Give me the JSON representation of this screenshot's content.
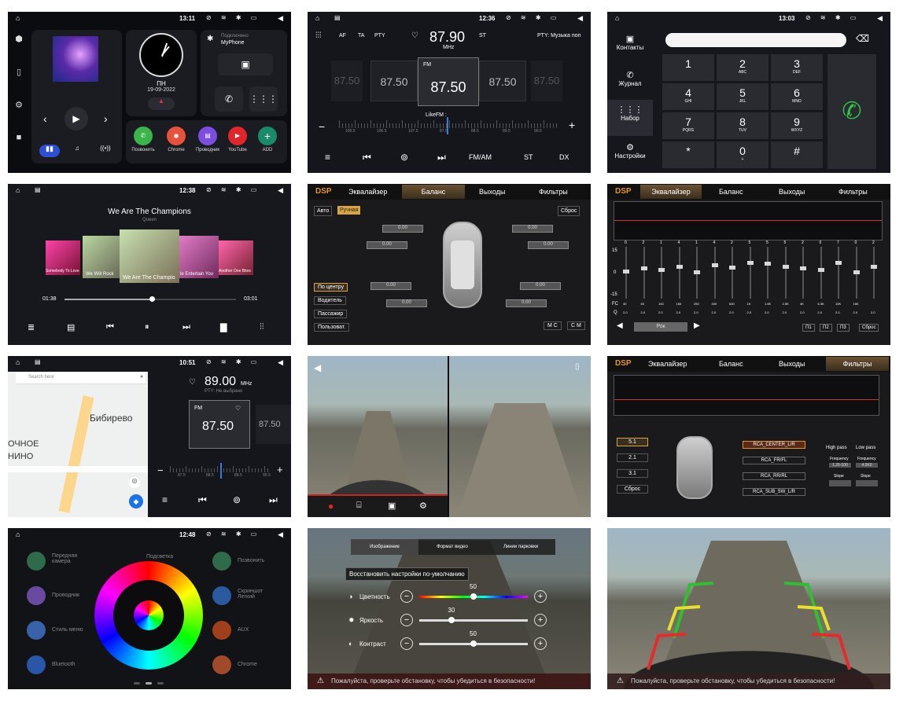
{
  "p1": {
    "time": "13:11",
    "side": [
      "cube-icon",
      "phone-icon",
      "gear-icon",
      "camera-icon"
    ],
    "day": "ПН",
    "date": "19-09-2022",
    "bt_title": "Подключено",
    "bt_device": "MyPhone",
    "apps": [
      {
        "label": "Позвонить",
        "color": "#3bb44a",
        "icon": "📞"
      },
      {
        "label": "Chrome",
        "color": "#e5533c",
        "icon": "◉"
      },
      {
        "label": "Проводник",
        "color": "#7b4de0",
        "icon": "▤"
      },
      {
        "label": "YouTube",
        "color": "#e0262a",
        "icon": "▶"
      },
      {
        "label": "ADD",
        "color": "#1a8b6a",
        "icon": "+"
      }
    ]
  },
  "p2": {
    "time": "12:36",
    "af": "AF",
    "ta": "TA",
    "pty": "PTY",
    "freq": "87.90",
    "mhz": "MHz",
    "st": "ST",
    "pty_text": "PTY: Музыка поп",
    "band": "FM",
    "cards": [
      "87.50",
      "87.50",
      "87.50",
      "87.50",
      "87.50"
    ],
    "like": "LikeFM :",
    "scale": [
      "105.5",
      "106.5",
      "107.5",
      "87.5",
      "88.5",
      "89.5",
      "90.5"
    ],
    "fmam": "FM/AM",
    "st2": "ST",
    "dx": "DX"
  },
  "p3": {
    "time": "13:03",
    "tabs": [
      "Контакты",
      "Журнал",
      "Набор",
      "Настройки"
    ],
    "keys": [
      [
        "1",
        ""
      ],
      [
        "2",
        "ABC"
      ],
      [
        "3",
        "DEF"
      ],
      [
        "4",
        "GHI"
      ],
      [
        "5",
        "JKL"
      ],
      [
        "6",
        "MNO"
      ],
      [
        "7",
        "PQRS"
      ],
      [
        "8",
        "TUV"
      ],
      [
        "9",
        "WXYZ"
      ],
      [
        "*",
        ""
      ],
      [
        "0",
        "+"
      ],
      [
        "#",
        ""
      ]
    ]
  },
  "p4": {
    "time": "12:38",
    "title": "We Are The Champions",
    "artist": "Queen",
    "albums": [
      "Somebody To Love",
      "We Will Rock",
      "We Are The Champio",
      "le Entertain You",
      "Another One Bites"
    ],
    "elapsed": "01:38",
    "total": "03:01",
    "progress": 0.51
  },
  "p5": {
    "dsp": "DSP",
    "tabs": [
      "Эквалайзер",
      "Баланс",
      "Выходы",
      "Фильтры"
    ],
    "auto": "Авто",
    "manual": "Ручная",
    "reset": "Сброс",
    "val": "0.00",
    "modes": [
      "По центру",
      "Водитель",
      "Пассажир",
      "Пользоват."
    ],
    "mc": "M C",
    "cm": "C M"
  },
  "p6": {
    "dsp": "DSP",
    "tabs": [
      "Эквалайзер",
      "Баланс",
      "Выходы",
      "Фильтры"
    ],
    "ylabels": [
      "15",
      "0",
      "-15"
    ],
    "gains": [
      "0",
      "2",
      "1",
      "2",
      "1",
      "2",
      "2",
      "3",
      "5",
      "2",
      "2",
      "1",
      "0",
      "2",
      "2"
    ],
    "gains_display": [
      "0",
      "2",
      "1",
      "4",
      "1",
      "4",
      "2",
      "5",
      "5",
      "5",
      "2",
      "0",
      "7",
      "0",
      "2"
    ],
    "fc": [
      "40",
      "63",
      "100",
      "160",
      "250",
      "400",
      "630",
      "1K",
      "1.6K",
      "2.5K",
      "4K",
      "6.3K",
      "10K",
      "16K"
    ],
    "fc_label": "FC",
    "q_label": "Q",
    "q": "2.0",
    "preset": "Рок",
    "p": [
      "П1",
      "П2",
      "П3"
    ],
    "reset": "Сброс",
    "knobs": [
      0.48,
      0.42,
      0.45,
      0.38,
      0.5,
      0.35,
      0.4,
      0.3,
      0.32,
      0.38,
      0.42,
      0.45,
      0.3,
      0.5,
      0.38
    ]
  },
  "p7": {
    "time": "10:51",
    "search": "Search here",
    "district": "Бибирево",
    "left1": "ОЧНОЕ",
    "left2": "НИНО",
    "freq": "89.00",
    "mhz": "MHz",
    "pty": "PTY: Не выбрано",
    "band": "FM",
    "main": "87.50",
    "side": "87.50",
    "scale": [
      "87.5",
      "88.5",
      "89.5",
      "90.5"
    ]
  },
  "p9": {
    "dsp": "DSP",
    "tabs": [
      "Эквалайзер",
      "Баланс",
      "Выходы",
      "Фильтры"
    ],
    "modes": [
      "5.1",
      "2.1",
      "3.1",
      "Сброс"
    ],
    "outs": [
      "RCA_CENTER_L/R",
      "RCA_FR/FL",
      "RCA_RR/RL",
      "RCA_SUB_SW_L/R"
    ],
    "hp": "High pass",
    "lp": "Low pass",
    "freq": "Frequency",
    "slope": "Slope",
    "fv1": "1.25-100",
    "fv2": "4.5K0"
  },
  "p10": {
    "time": "12:48",
    "left": [
      "Передняя камера",
      "Проводник",
      "Стиль меню",
      "Bluetooth"
    ],
    "top": "Подсветка",
    "right": [
      "Позвонить",
      "Скриншот Легкий",
      "AUX",
      "Chrome"
    ]
  },
  "p11": {
    "tabs": [
      "Изображение",
      "Формат видео",
      "Линии парковки"
    ],
    "restore": "Восстановить настройки по-умолчанию",
    "sliders": [
      {
        "label": "Цветность",
        "value": "50",
        "pos": 0.5
      },
      {
        "label": "Яркость",
        "value": "30",
        "pos": 0.3
      },
      {
        "label": "Контраст",
        "value": "50",
        "pos": 0.5
      }
    ],
    "warn": "Пожалуйста, проверьте обстановку, чтобы убедиться в безопасности!"
  },
  "p12": {
    "warn": "Пожалуйста, проверьте обстановку, чтобы убедиться в безопасности!"
  },
  "colors": {
    "accent_gold": "#d9a544",
    "green_call": "#2fc24a",
    "dsp_orange": "#e3922a"
  }
}
